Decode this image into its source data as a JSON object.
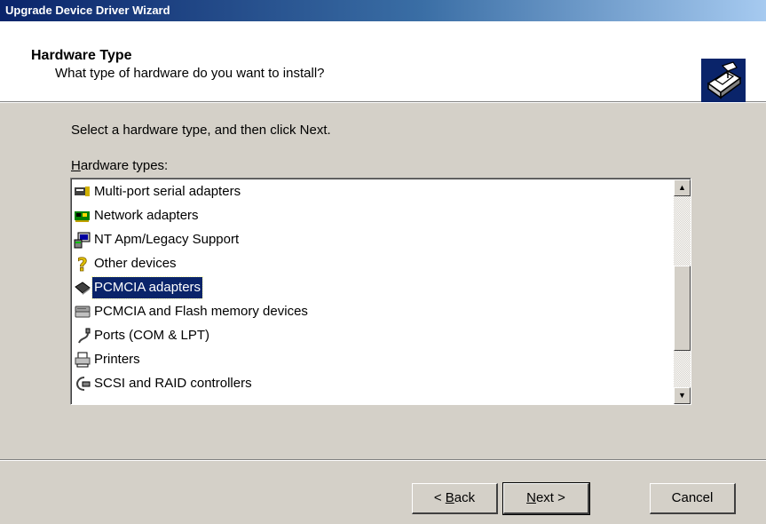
{
  "window": {
    "title": "Upgrade Device Driver Wizard"
  },
  "header": {
    "title": "Hardware Type",
    "subtitle": "What type of hardware do you want to install?",
    "icon": "hardware-wizard-icon"
  },
  "body": {
    "instruction": "Select a hardware type, and then click Next.",
    "list_label_access": "H",
    "list_label_rest": "ardware types:"
  },
  "hardware_list": {
    "items": [
      {
        "label": "Multi-port serial adapters",
        "icon": "serial-adapter-icon"
      },
      {
        "label": "Network adapters",
        "icon": "network-adapter-icon"
      },
      {
        "label": "NT Apm/Legacy Support",
        "icon": "computer-icon"
      },
      {
        "label": "Other devices",
        "icon": "question-icon"
      },
      {
        "label": "PCMCIA adapters",
        "icon": "pcmcia-icon"
      },
      {
        "label": "PCMCIA and Flash memory devices",
        "icon": "flash-memory-icon"
      },
      {
        "label": "Ports (COM & LPT)",
        "icon": "port-icon"
      },
      {
        "label": "Printers",
        "icon": "printer-icon"
      },
      {
        "label": "SCSI and RAID controllers",
        "icon": "scsi-icon"
      }
    ],
    "selected": "PCMCIA adapters"
  },
  "buttons": {
    "back_prefix": "< ",
    "back_access": "B",
    "back_rest": "ack",
    "next_access": "N",
    "next_rest": "ext >",
    "cancel": "Cancel"
  },
  "colors": {
    "title_bar": "#0a246a",
    "selection": "#0a246a",
    "dialog": "#d4d0c8"
  }
}
